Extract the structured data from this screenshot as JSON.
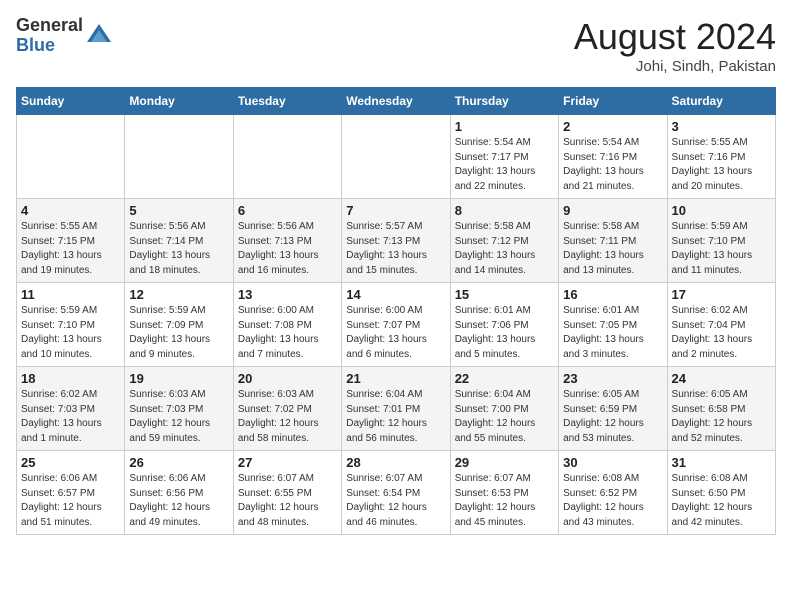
{
  "logo": {
    "general": "General",
    "blue": "Blue"
  },
  "title": "August 2024",
  "location": "Johi, Sindh, Pakistan",
  "days_of_week": [
    "Sunday",
    "Monday",
    "Tuesday",
    "Wednesday",
    "Thursday",
    "Friday",
    "Saturday"
  ],
  "weeks": [
    [
      {
        "day": "",
        "info": ""
      },
      {
        "day": "",
        "info": ""
      },
      {
        "day": "",
        "info": ""
      },
      {
        "day": "",
        "info": ""
      },
      {
        "day": "1",
        "info": "Sunrise: 5:54 AM\nSunset: 7:17 PM\nDaylight: 13 hours\nand 22 minutes."
      },
      {
        "day": "2",
        "info": "Sunrise: 5:54 AM\nSunset: 7:16 PM\nDaylight: 13 hours\nand 21 minutes."
      },
      {
        "day": "3",
        "info": "Sunrise: 5:55 AM\nSunset: 7:16 PM\nDaylight: 13 hours\nand 20 minutes."
      }
    ],
    [
      {
        "day": "4",
        "info": "Sunrise: 5:55 AM\nSunset: 7:15 PM\nDaylight: 13 hours\nand 19 minutes."
      },
      {
        "day": "5",
        "info": "Sunrise: 5:56 AM\nSunset: 7:14 PM\nDaylight: 13 hours\nand 18 minutes."
      },
      {
        "day": "6",
        "info": "Sunrise: 5:56 AM\nSunset: 7:13 PM\nDaylight: 13 hours\nand 16 minutes."
      },
      {
        "day": "7",
        "info": "Sunrise: 5:57 AM\nSunset: 7:13 PM\nDaylight: 13 hours\nand 15 minutes."
      },
      {
        "day": "8",
        "info": "Sunrise: 5:58 AM\nSunset: 7:12 PM\nDaylight: 13 hours\nand 14 minutes."
      },
      {
        "day": "9",
        "info": "Sunrise: 5:58 AM\nSunset: 7:11 PM\nDaylight: 13 hours\nand 13 minutes."
      },
      {
        "day": "10",
        "info": "Sunrise: 5:59 AM\nSunset: 7:10 PM\nDaylight: 13 hours\nand 11 minutes."
      }
    ],
    [
      {
        "day": "11",
        "info": "Sunrise: 5:59 AM\nSunset: 7:10 PM\nDaylight: 13 hours\nand 10 minutes."
      },
      {
        "day": "12",
        "info": "Sunrise: 5:59 AM\nSunset: 7:09 PM\nDaylight: 13 hours\nand 9 minutes."
      },
      {
        "day": "13",
        "info": "Sunrise: 6:00 AM\nSunset: 7:08 PM\nDaylight: 13 hours\nand 7 minutes."
      },
      {
        "day": "14",
        "info": "Sunrise: 6:00 AM\nSunset: 7:07 PM\nDaylight: 13 hours\nand 6 minutes."
      },
      {
        "day": "15",
        "info": "Sunrise: 6:01 AM\nSunset: 7:06 PM\nDaylight: 13 hours\nand 5 minutes."
      },
      {
        "day": "16",
        "info": "Sunrise: 6:01 AM\nSunset: 7:05 PM\nDaylight: 13 hours\nand 3 minutes."
      },
      {
        "day": "17",
        "info": "Sunrise: 6:02 AM\nSunset: 7:04 PM\nDaylight: 13 hours\nand 2 minutes."
      }
    ],
    [
      {
        "day": "18",
        "info": "Sunrise: 6:02 AM\nSunset: 7:03 PM\nDaylight: 13 hours\nand 1 minute."
      },
      {
        "day": "19",
        "info": "Sunrise: 6:03 AM\nSunset: 7:03 PM\nDaylight: 12 hours\nand 59 minutes."
      },
      {
        "day": "20",
        "info": "Sunrise: 6:03 AM\nSunset: 7:02 PM\nDaylight: 12 hours\nand 58 minutes."
      },
      {
        "day": "21",
        "info": "Sunrise: 6:04 AM\nSunset: 7:01 PM\nDaylight: 12 hours\nand 56 minutes."
      },
      {
        "day": "22",
        "info": "Sunrise: 6:04 AM\nSunset: 7:00 PM\nDaylight: 12 hours\nand 55 minutes."
      },
      {
        "day": "23",
        "info": "Sunrise: 6:05 AM\nSunset: 6:59 PM\nDaylight: 12 hours\nand 53 minutes."
      },
      {
        "day": "24",
        "info": "Sunrise: 6:05 AM\nSunset: 6:58 PM\nDaylight: 12 hours\nand 52 minutes."
      }
    ],
    [
      {
        "day": "25",
        "info": "Sunrise: 6:06 AM\nSunset: 6:57 PM\nDaylight: 12 hours\nand 51 minutes."
      },
      {
        "day": "26",
        "info": "Sunrise: 6:06 AM\nSunset: 6:56 PM\nDaylight: 12 hours\nand 49 minutes."
      },
      {
        "day": "27",
        "info": "Sunrise: 6:07 AM\nSunset: 6:55 PM\nDaylight: 12 hours\nand 48 minutes."
      },
      {
        "day": "28",
        "info": "Sunrise: 6:07 AM\nSunset: 6:54 PM\nDaylight: 12 hours\nand 46 minutes."
      },
      {
        "day": "29",
        "info": "Sunrise: 6:07 AM\nSunset: 6:53 PM\nDaylight: 12 hours\nand 45 minutes."
      },
      {
        "day": "30",
        "info": "Sunrise: 6:08 AM\nSunset: 6:52 PM\nDaylight: 12 hours\nand 43 minutes."
      },
      {
        "day": "31",
        "info": "Sunrise: 6:08 AM\nSunset: 6:50 PM\nDaylight: 12 hours\nand 42 minutes."
      }
    ]
  ]
}
